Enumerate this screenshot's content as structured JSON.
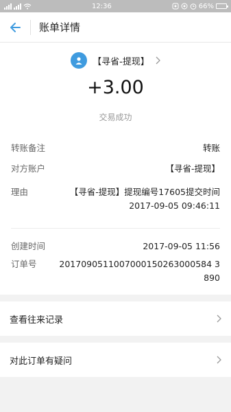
{
  "status_bar": {
    "time": "12:36",
    "battery": "66%"
  },
  "nav": {
    "title": "账单详情"
  },
  "transaction": {
    "counterpart": "【寻省-提现】",
    "amount": "+3.00",
    "status": "交易成功"
  },
  "details": {
    "note_label": "转账备注",
    "note_value": "转账",
    "account_label": "对方账户",
    "account_value": "【寻省-提现】",
    "reason_label": "理由",
    "reason_line1": "【寻省-提现】提现编号17605提交时间",
    "reason_line2": "2017-09-05 09:46:11",
    "created_label": "创建时间",
    "created_value": "2017-09-05 11:56",
    "order_label": "订单号",
    "order_value": "2017090511007000150263000584 3890"
  },
  "links": {
    "history": "查看往来记录",
    "question": "对此订单有疑问"
  },
  "colors": {
    "accent": "#3f9bdf",
    "status_bar": "#bcbcbc"
  }
}
